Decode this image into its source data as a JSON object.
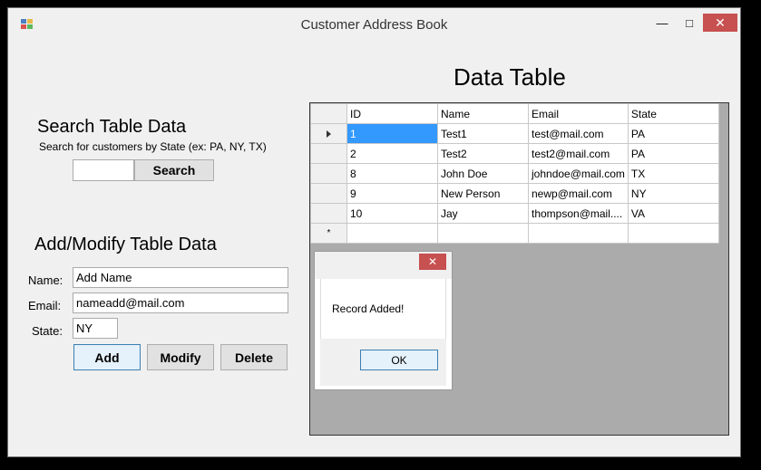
{
  "window": {
    "title": "Customer Address Book",
    "minimize_glyph": "—",
    "maximize_glyph": "□",
    "close_glyph": "✕"
  },
  "search": {
    "heading": "Search Table Data",
    "hint": "Search for customers by State (ex: PA, NY, TX)",
    "input_value": "",
    "button_label": "Search"
  },
  "edit": {
    "heading": "Add/Modify Table Data",
    "name_label": "Name:",
    "name_value": "Add Name",
    "email_label": "Email:",
    "email_value": "nameadd@mail.com",
    "state_label": "State:",
    "state_value": "NY",
    "add_label": "Add",
    "modify_label": "Modify",
    "delete_label": "Delete"
  },
  "table": {
    "heading": "Data Table",
    "columns": [
      "ID",
      "Name",
      "Email",
      "State"
    ],
    "rows": [
      [
        "1",
        "Test1",
        "test@mail.com",
        "PA"
      ],
      [
        "2",
        "Test2",
        "test2@mail.com",
        "PA"
      ],
      [
        "8",
        "John Doe",
        "johndoe@mail.com",
        "TX"
      ],
      [
        "9",
        "New Person",
        "newp@mail.com",
        "NY"
      ],
      [
        "10",
        "Jay",
        "thompson@mail....",
        "VA"
      ]
    ],
    "new_row_marker": "*"
  },
  "dialog": {
    "message": "Record Added!",
    "ok_label": "OK",
    "close_glyph": "✕"
  },
  "colors": {
    "close_button": "#c75050",
    "selection": "#3399ff",
    "grid_background": "#ababab"
  }
}
